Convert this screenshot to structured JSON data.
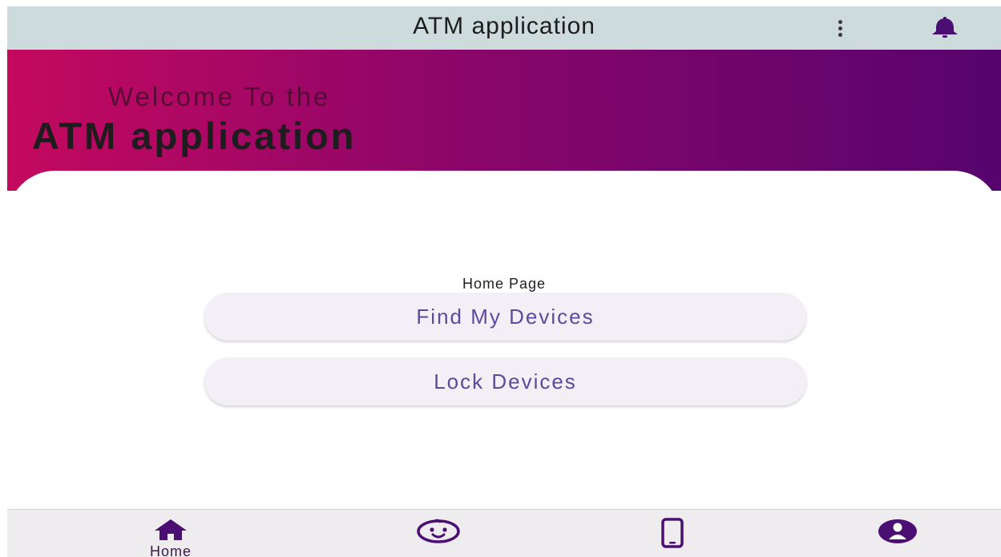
{
  "appbar": {
    "title": "ATM application",
    "more_icon": "more-vertical-icon",
    "bell_icon": "bell-icon"
  },
  "hero": {
    "welcome": "Welcome To the",
    "title": "ATM application",
    "gradient": [
      "#c4095f",
      "#8c066a",
      "#57046e"
    ]
  },
  "main": {
    "page_label": "Home Page",
    "buttons": [
      {
        "label": "Find My Devices"
      },
      {
        "label": "Lock Devices"
      }
    ]
  },
  "bottom_nav": {
    "items": [
      {
        "label": "Home",
        "icon": "home-icon",
        "active": true
      },
      {
        "label": "",
        "icon": "face-icon"
      },
      {
        "label": "",
        "icon": "tablet-icon"
      },
      {
        "label": "",
        "icon": "profile-icon"
      }
    ]
  },
  "colors": {
    "primary": "#5a0f7a",
    "appbar_bg": "#cddbdc",
    "button_text": "#5c4a9e",
    "button_bg": "#f4eff7"
  }
}
